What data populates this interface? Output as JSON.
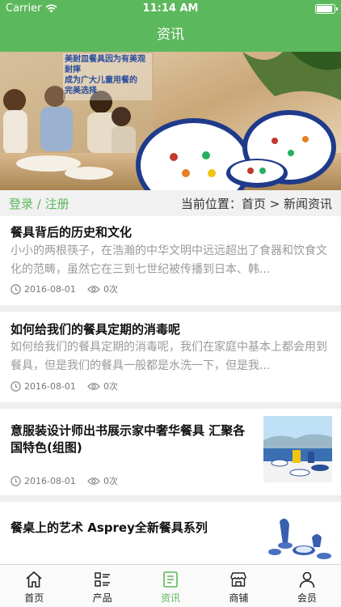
{
  "status": {
    "carrier": "Carrier",
    "time": "11:14 AM",
    "battery_level": 0.95
  },
  "navbar": {
    "title": "资讯"
  },
  "banner": {
    "text_lines": [
      "美耐皿餐具因为有美观",
      "耐摔",
      "成为广大儿童用餐的",
      "完美选择"
    ]
  },
  "crumbs": {
    "login": "登录",
    "slash": " / ",
    "register": "注册",
    "location": "当前位置：首页 > 新闻资讯"
  },
  "articles": [
    {
      "title": "餐具背后的历史和文化",
      "summary": "小小的两根筷子，在浩瀚的中华文明中远远超出了食器和饮食文化的范畴，虽然它在三到七世纪被传播到日本、韩...",
      "date": "2016-08-01",
      "views": "0次"
    },
    {
      "title": "如何给我们的餐具定期的消毒呢",
      "summary": "如何给我们的餐具定期的消毒呢，我们在家庭中基本上都会用到餐具，但是我们的餐具一般都是水洗一下，但是我...",
      "date": "2016-08-01",
      "views": "0次"
    },
    {
      "title": "意服装设计师出书展示家中奢华餐具 汇聚各国特色(组图)",
      "date": "2016-08-01",
      "views": "0次"
    },
    {
      "title": "餐桌上的艺术 Asprey全新餐具系列"
    }
  ],
  "tabs": [
    {
      "label": "首页",
      "icon": "home-icon"
    },
    {
      "label": "产品",
      "icon": "list-icon"
    },
    {
      "label": "资讯",
      "icon": "news-icon",
      "active": true
    },
    {
      "label": "商铺",
      "icon": "store-icon"
    },
    {
      "label": "会员",
      "icon": "user-icon"
    }
  ],
  "colors": {
    "accent": "#5cb85c",
    "separator": "#eeeeee",
    "summary_text": "#9a9a9a"
  }
}
